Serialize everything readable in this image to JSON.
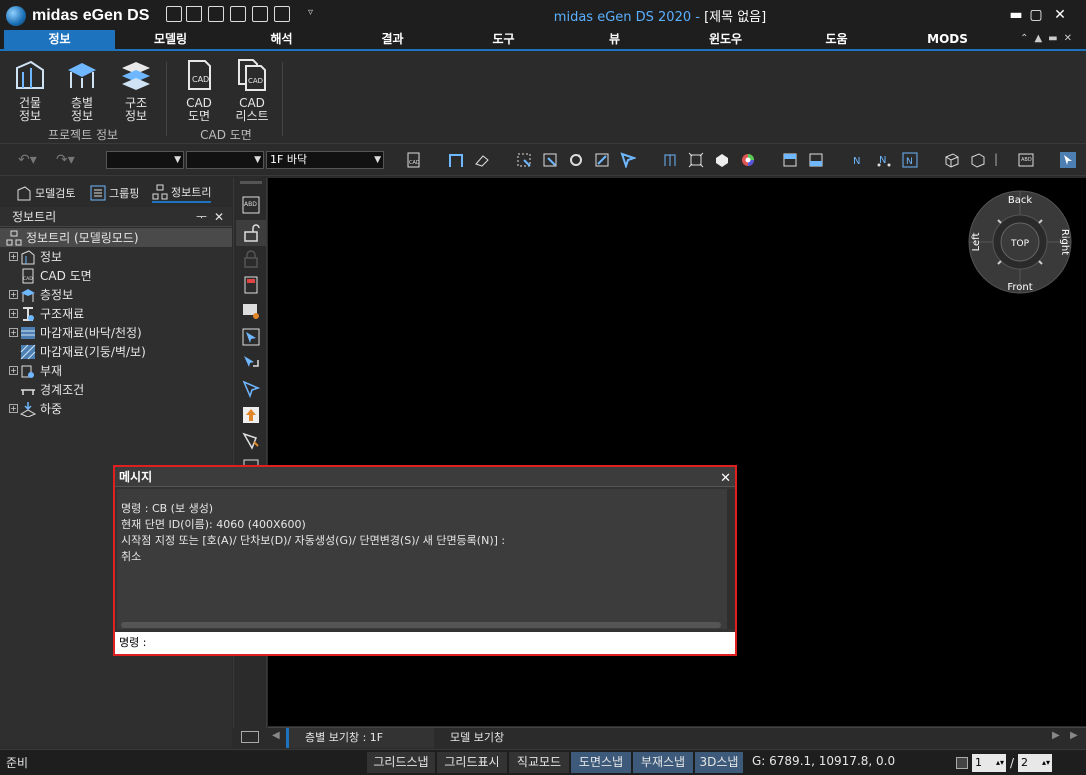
{
  "app": {
    "logo_text": "midas eGen DS",
    "title_accent": "midas eGen DS 2020 - ",
    "title_doc": "[제목 없음]"
  },
  "menu": [
    "정보",
    "모델링",
    "해석",
    "결과",
    "도구",
    "뷰",
    "윈도우",
    "도움",
    "MODS"
  ],
  "ribbon": {
    "buttons": [
      {
        "line1": "건물",
        "line2": "정보",
        "icon": "building-icon"
      },
      {
        "line1": "층별",
        "line2": "정보",
        "icon": "floor-icon"
      },
      {
        "line1": "구조",
        "line2": "정보",
        "icon": "structure-icon"
      },
      {
        "line1": "CAD",
        "line2": "도면",
        "icon": "cad-drawing-icon"
      },
      {
        "line1": "CAD",
        "line2": "리스트",
        "icon": "cad-list-icon"
      }
    ],
    "groups": [
      "프로젝트 정보",
      "CAD 도면"
    ]
  },
  "toolbar": {
    "combo1": "",
    "combo2": "",
    "floor_combo": "1F 바닥"
  },
  "left_tabs": [
    "모델검토",
    "그룹핑",
    "정보트리"
  ],
  "panel": {
    "title": "정보트리",
    "pin": "ᅮ",
    "close": "✕"
  },
  "tree": [
    {
      "label": "정보트리 (모델링모드)",
      "root": true,
      "expand": false
    },
    {
      "label": "정보",
      "expand": true
    },
    {
      "label": "CAD 도면",
      "expand": false
    },
    {
      "label": "층정보",
      "expand": true
    },
    {
      "label": "구조재료",
      "expand": true
    },
    {
      "label": "마감재료(바닥/천정)",
      "expand": true
    },
    {
      "label": "마감재료(기둥/벽/보)",
      "expand": false
    },
    {
      "label": "부재",
      "expand": true
    },
    {
      "label": "경계조건",
      "expand": false
    },
    {
      "label": "하중",
      "expand": true
    }
  ],
  "viewcube": {
    "top": "TOP",
    "back": "Back",
    "front": "Front",
    "left": "Left",
    "right": "Right"
  },
  "message": {
    "title": "메시지",
    "close": "✕",
    "lines": [
      "명령 : CB (보 생성)",
      "현재 단면 ID(이름): 4060 (400X600)",
      "시작점 지정 또는 [호(A)/ 단차보(D)/ 자동생성(G)/ 단면변경(S)/ 새 단면등록(N)] :",
      "취소"
    ],
    "command_prompt": "명령 :"
  },
  "view_tabs": [
    "층별 보기창 : 1F",
    "모델 보기창"
  ],
  "status": {
    "ready": "준비",
    "buttons": [
      {
        "label": "그리드스냅",
        "on": false
      },
      {
        "label": "그리드표시",
        "on": false
      },
      {
        "label": "직교모드",
        "on": false
      },
      {
        "label": "도면스냅",
        "on": true
      },
      {
        "label": "부재스냅",
        "on": true
      },
      {
        "label": "3D스냅",
        "on": true
      }
    ],
    "coords": "G: 6789.1, 10917.8, 0.0",
    "page_current": "1",
    "page_sep": "/",
    "page_total": "2"
  },
  "colors": {
    "accent": "#1e73be",
    "highlight_border": "#e02020"
  }
}
